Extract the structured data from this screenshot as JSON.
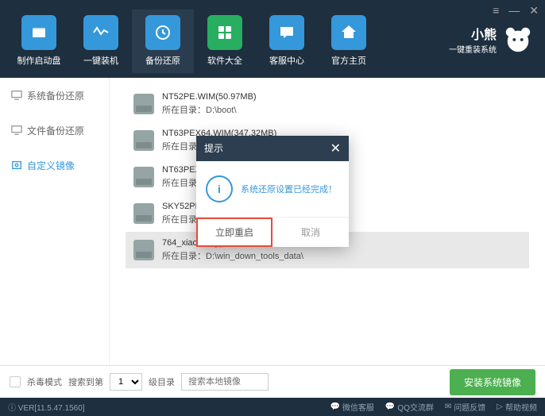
{
  "window": {
    "menu": "≡",
    "min": "—",
    "close": "✕"
  },
  "brand": {
    "title": "小熊",
    "sub": "一键重装系统"
  },
  "nav": [
    {
      "label": "制作启动盘",
      "color": "#3498db"
    },
    {
      "label": "一键装机",
      "color": "#3498db"
    },
    {
      "label": "备份还原",
      "color": "#3498db",
      "active": true
    },
    {
      "label": "软件大全",
      "color": "#27ae60"
    },
    {
      "label": "客服中心",
      "color": "#3498db"
    },
    {
      "label": "官方主页",
      "color": "#3498db"
    }
  ],
  "sidebar": [
    {
      "label": "系统备份还原"
    },
    {
      "label": "文件备份还原"
    },
    {
      "label": "自定义镜像",
      "active": true
    }
  ],
  "files": [
    {
      "name": "NT52PE.WIM(50.97MB)",
      "path": "所在目录：D:\\boot\\"
    },
    {
      "name": "NT63PEX64.WIM(347.32MB)",
      "path": "所在目录：D:\\boot\\"
    },
    {
      "name": "NT63PEX86.WIM",
      "path": "所在目录：D:\\boo"
    },
    {
      "name": "SKY52PE.ISO(51.3",
      "path": "所在目录：D:\\boo"
    },
    {
      "name": "764_xiaoxiong_18",
      "path": "所在目录：D:\\win_down_tools_data\\",
      "sel": true
    }
  ],
  "bottom": {
    "virus": "杀毒模式",
    "searchTo": "搜索到第",
    "level": "1",
    "levelLabel": "级目录",
    "searchPlaceholder": "搜索本地镜像",
    "install": "安装系统镜像"
  },
  "footer": {
    "ver": "VER[11.5.47.1560]",
    "wechat": "微信客服",
    "qq": "QQ交流群",
    "feedback": "问题反馈",
    "help": "帮助视频"
  },
  "dialog": {
    "title": "提示",
    "message": "系统还原设置已经完成！",
    "confirm": "立即重启",
    "cancel": "取消"
  }
}
